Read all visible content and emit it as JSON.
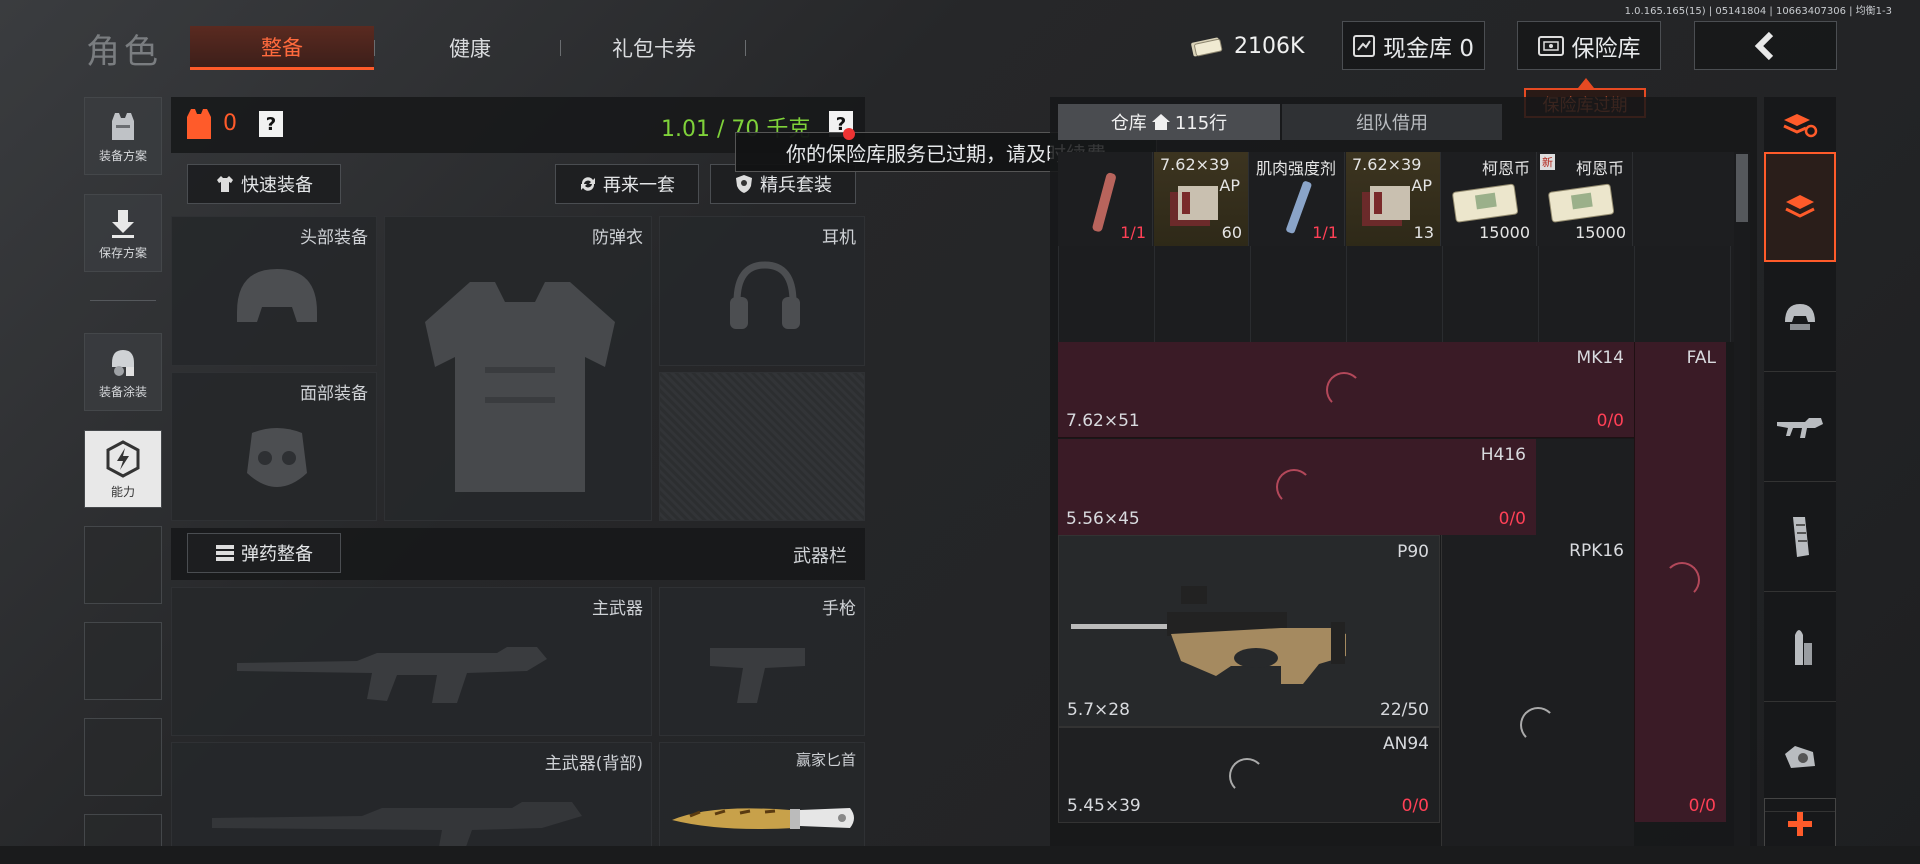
{
  "version_text": "1.0.165.165(15) | 05141804 | 10663407306 | 均衡1-3",
  "header": {
    "title": "角色",
    "tabs": [
      "整备",
      "健康",
      "礼包卡券"
    ],
    "money": "2106K",
    "cash_vault": "现金库 0",
    "insurance_vault": "保险库",
    "back_icon": "chevron-left-icon",
    "expired_badge": "保险库过期"
  },
  "left_nav": [
    {
      "label": "装备方案",
      "icon": "vest-icon"
    },
    {
      "label": "保存方案",
      "icon": "download-icon"
    },
    {
      "label": "装备涂装",
      "icon": "helmet-paint-icon"
    },
    {
      "label": "能力",
      "icon": "ability-icon"
    }
  ],
  "equip": {
    "vest_count": "0",
    "help": "?",
    "weight": "1.01 / 70 千克",
    "quick_equip": "快速装备",
    "again": "再来一套",
    "elite": "精兵套装",
    "tooltip": "你的保险库服务已过期，请及时续费",
    "slots": {
      "head": "头部装备",
      "armor": "防弹衣",
      "headset": "耳机",
      "face": "面部装备"
    },
    "ammo_button": "弹药整备",
    "weapon_bar": "武器栏",
    "primary": "主武器",
    "pistol": "手枪",
    "primary_back": "主武器(背部)",
    "knife": "赢家匕首"
  },
  "storage": {
    "tab_warehouse": "仓库",
    "rows": "115行",
    "tab_team": "组队借用",
    "items": [
      {
        "name": "",
        "count": "1/1",
        "count_red": true
      },
      {
        "name": "7.62×39",
        "sub": "AP",
        "count": "60"
      },
      {
        "name": "肌肉强度剂",
        "count": "1/1",
        "count_red": true
      },
      {
        "name": "7.62×39",
        "sub": "AP",
        "count": "13"
      },
      {
        "name": "柯恩币",
        "count": "15000"
      },
      {
        "name": "柯恩币",
        "count": "15000",
        "badge": "新"
      }
    ],
    "weapons": [
      {
        "caliber": "7.62×51",
        "name": "MK14",
        "count_a": "0",
        "count_b": "/0"
      },
      {
        "name": "FAL"
      },
      {
        "caliber": "5.56×45",
        "name": "H416",
        "count_a": "0",
        "count_b": "/0"
      },
      {
        "caliber": "5.7×28",
        "name": "P90",
        "count": "22/50"
      },
      {
        "name": "RPK16"
      },
      {
        "caliber": "5.45×39",
        "name": "AN94",
        "count_a": "0",
        "count_b": "/0"
      },
      {
        "count_a": "0",
        "count_b": "/0"
      }
    ]
  },
  "right_nav": [
    "sort-icon",
    "storage-icon",
    "helmet-icon",
    "rifle-icon",
    "magazine-icon",
    "bullet-icon",
    "scope-icon",
    "plus-icon"
  ],
  "colors": {
    "accent": "#ff5b2a",
    "green": "#7fd23a",
    "red": "#ff4056",
    "maroon": "#3a1b26"
  }
}
